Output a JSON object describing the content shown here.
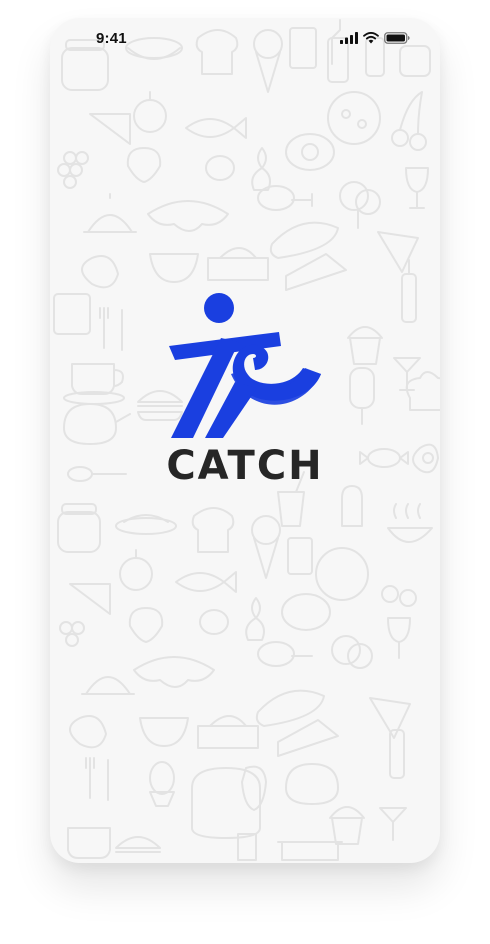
{
  "status_bar": {
    "time": "9:41",
    "icons": [
      "cellular-signal-icon",
      "wifi-icon",
      "battery-icon"
    ]
  },
  "splash": {
    "brand_name": "CATCH",
    "logo_icon": "running-figure-logo-icon",
    "background_pattern": "food-doodle-pattern"
  },
  "colors": {
    "brand_blue": "#1a3fe0",
    "brand_text": "#262626",
    "background": "#f7f7f7",
    "doodle_stroke": "#e3e3e3"
  }
}
